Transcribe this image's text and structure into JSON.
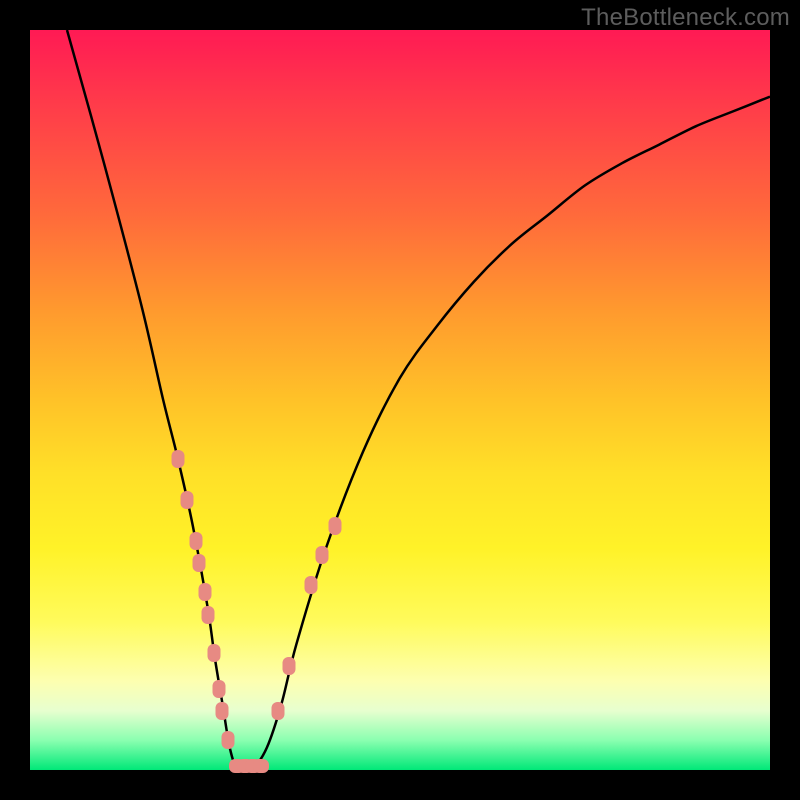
{
  "watermark": "TheBottleneck.com",
  "colors": {
    "marker_fill": "#e78a83",
    "curve_stroke": "#000000"
  },
  "chart_data": {
    "type": "line",
    "title": "",
    "xlabel": "",
    "ylabel": "",
    "xlim": [
      0,
      100
    ],
    "ylim": [
      0,
      100
    ],
    "grid": false,
    "legend": false,
    "series": [
      {
        "name": "bottleneck-curve",
        "x": [
          5,
          10,
          15,
          18,
          20,
          22,
          24,
          25,
          26,
          27,
          28,
          29,
          30,
          32,
          34,
          36,
          40,
          45,
          50,
          55,
          60,
          65,
          70,
          75,
          80,
          85,
          90,
          95,
          100
        ],
        "values": [
          100,
          82,
          63,
          50,
          42,
          33,
          22,
          15,
          9,
          3,
          0,
          0,
          0,
          3,
          9,
          17,
          30,
          43,
          53,
          60,
          66,
          71,
          75,
          79,
          82,
          84.5,
          87,
          89,
          91
        ]
      }
    ],
    "markers": [
      {
        "x": 20.0,
        "y": 42.0
      },
      {
        "x": 21.2,
        "y": 36.5
      },
      {
        "x": 22.4,
        "y": 31.0
      },
      {
        "x": 22.8,
        "y": 28.0
      },
      {
        "x": 23.6,
        "y": 24.0
      },
      {
        "x": 24.0,
        "y": 21.0
      },
      {
        "x": 24.8,
        "y": 15.8
      },
      {
        "x": 25.5,
        "y": 11.0
      },
      {
        "x": 26.0,
        "y": 8.0
      },
      {
        "x": 26.8,
        "y": 4.0
      },
      {
        "x": 28.0,
        "y": 0.5
      },
      {
        "x": 29.0,
        "y": 0.5
      },
      {
        "x": 30.2,
        "y": 0.5
      },
      {
        "x": 31.2,
        "y": 0.5
      },
      {
        "x": 33.5,
        "y": 8.0
      },
      {
        "x": 35.0,
        "y": 14.0
      },
      {
        "x": 38.0,
        "y": 25.0
      },
      {
        "x": 39.5,
        "y": 29.0
      },
      {
        "x": 41.2,
        "y": 33.0
      }
    ],
    "marker_size_px": {
      "w": 13,
      "h": 18
    },
    "bottom_marker_size_px": {
      "w": 16,
      "h": 14
    }
  }
}
